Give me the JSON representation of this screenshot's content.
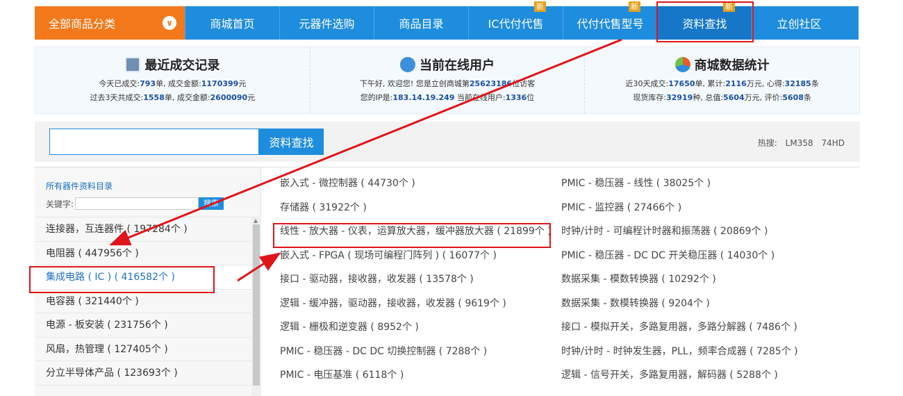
{
  "nav": {
    "category_label": "全部商品分类",
    "items": [
      {
        "label": "商城首页",
        "new": ""
      },
      {
        "label": "元器件选购",
        "new": ""
      },
      {
        "label": "商品目录",
        "new": ""
      },
      {
        "label": "IC代付代售",
        "new": "新"
      },
      {
        "label": "代付代售型号",
        "new": "新"
      },
      {
        "label": "资料查找",
        "new": "新"
      },
      {
        "label": "立创社区",
        "new": ""
      }
    ]
  },
  "stats": {
    "recent": {
      "title": "最近成交记录",
      "today_pre": "今天已成交:",
      "today_count": "793",
      "today_mid": "单, 成交金额:",
      "today_amount": "1170399",
      "today_post": "元",
      "three_pre": "过去3天共成交:",
      "three_count": "1558",
      "three_mid": "单, 成交金额:",
      "three_amount": "2600090",
      "three_post": "元"
    },
    "online": {
      "title": "当前在线用户",
      "greet_pre": "下午好, 欢迎您! 您是立创商城第",
      "visitor_no": "25623186",
      "greet_post": "位访客",
      "ip_pre": "您的IP是:",
      "ip": "183.14.19.249",
      "ip_mid": " 当前在线用户:",
      "online_count": "1336",
      "ip_post": "位"
    },
    "mall": {
      "title": "商城数据统计",
      "l1_pre": "近30天成交:",
      "deals": "17650",
      "l1_a": "单, 累计:",
      "total": "2116",
      "l1_b": "万元, 心得:",
      "reviews": "32185",
      "l1_post": "条",
      "l2_pre": "现货库存:",
      "stock": "32919",
      "l2_a": "种, 总值:",
      "value": "5604",
      "l2_b": "万元, 评价:",
      "ratings": "5608",
      "l2_post": "条"
    }
  },
  "search": {
    "button": "资料查找",
    "hot_label": "热搜:",
    "hot_terms": [
      "LM358",
      "74HD"
    ]
  },
  "sidebar": {
    "title_link": "所有器件资料目录",
    "keyword_label": "关键字:",
    "keyword_button": "搜索",
    "items": [
      "连接器，互连器件 ( 197284个 )",
      "电阻器 ( 447956个 )",
      "集成电路 ( IC ) ( 416582个 )",
      "电容器 ( 321440个 )",
      "电源 - 板安装 ( 231756个 )",
      "风扇，热管理 ( 127405个 )",
      "分立半导体产品 ( 123693个 )"
    ]
  },
  "categories": {
    "left": [
      "嵌入式 - 微控制器 ( 44730个 )",
      "存储器 ( 31922个 )",
      "线性 - 放大器 - 仪表，运算放大器，缓冲器放大器 ( 21899个 )",
      "嵌入式 - FPGA ( 现场可编程门阵列 ) ( 16077个 )",
      "接口 - 驱动器，接收器，收发器 ( 13578个 )",
      "逻辑 - 缓冲器，驱动器，接收器，收发器 ( 9619个 )",
      "逻辑 - 栅极和逆变器 ( 8952个 )",
      "PMIC - 稳压器 - DC DC 切换控制器 ( 7288个 )",
      "PMIC - 电压基准 ( 6118个 )"
    ],
    "right": [
      "PMIC - 稳压器 - 线性 ( 38025个 )",
      "PMIC - 监控器 ( 27466个 )",
      "时钟/计时 - 可编程计时器和振荡器 ( 20869个 )",
      "PMIC - 稳压器 - DC DC 开关稳压器 ( 14030个 )",
      "数据采集 - 模数转换器 ( 10292个 )",
      "数据采集 - 数模转换器 ( 9204个 )",
      "接口 - 模拟开关，多路复用器，多路分解器 ( 7486个 )",
      "时钟/计时 - 时钟发生器，PLL，频率合成器 ( 7285个 )",
      "逻辑 - 信号开关，多路复用器，解码器 ( 5288个 )"
    ]
  },
  "colors": {
    "nav_blue": "#1f8ddd",
    "category_orange": "#f3791b",
    "annotation_red": "#e0141a",
    "link_blue": "#1a6fc4"
  }
}
